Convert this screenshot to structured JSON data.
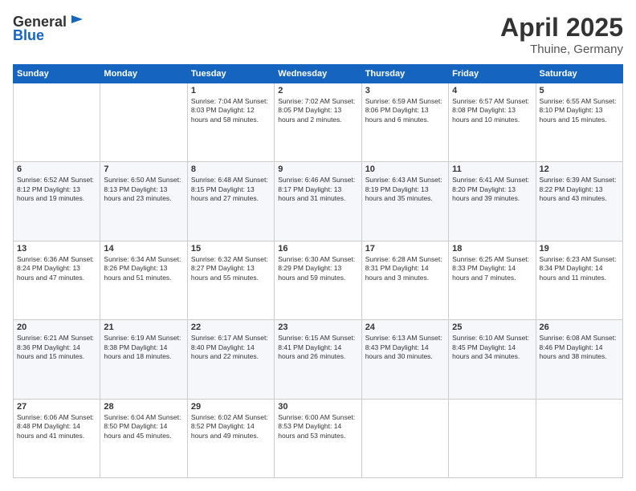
{
  "header": {
    "logo_line1": "General",
    "logo_line2": "Blue",
    "title": "April 2025",
    "location": "Thuine, Germany"
  },
  "days_of_week": [
    "Sunday",
    "Monday",
    "Tuesday",
    "Wednesday",
    "Thursday",
    "Friday",
    "Saturday"
  ],
  "weeks": [
    [
      {
        "day": "",
        "info": ""
      },
      {
        "day": "",
        "info": ""
      },
      {
        "day": "1",
        "info": "Sunrise: 7:04 AM\nSunset: 8:03 PM\nDaylight: 12 hours\nand 58 minutes."
      },
      {
        "day": "2",
        "info": "Sunrise: 7:02 AM\nSunset: 8:05 PM\nDaylight: 13 hours\nand 2 minutes."
      },
      {
        "day": "3",
        "info": "Sunrise: 6:59 AM\nSunset: 8:06 PM\nDaylight: 13 hours\nand 6 minutes."
      },
      {
        "day": "4",
        "info": "Sunrise: 6:57 AM\nSunset: 8:08 PM\nDaylight: 13 hours\nand 10 minutes."
      },
      {
        "day": "5",
        "info": "Sunrise: 6:55 AM\nSunset: 8:10 PM\nDaylight: 13 hours\nand 15 minutes."
      }
    ],
    [
      {
        "day": "6",
        "info": "Sunrise: 6:52 AM\nSunset: 8:12 PM\nDaylight: 13 hours\nand 19 minutes."
      },
      {
        "day": "7",
        "info": "Sunrise: 6:50 AM\nSunset: 8:13 PM\nDaylight: 13 hours\nand 23 minutes."
      },
      {
        "day": "8",
        "info": "Sunrise: 6:48 AM\nSunset: 8:15 PM\nDaylight: 13 hours\nand 27 minutes."
      },
      {
        "day": "9",
        "info": "Sunrise: 6:46 AM\nSunset: 8:17 PM\nDaylight: 13 hours\nand 31 minutes."
      },
      {
        "day": "10",
        "info": "Sunrise: 6:43 AM\nSunset: 8:19 PM\nDaylight: 13 hours\nand 35 minutes."
      },
      {
        "day": "11",
        "info": "Sunrise: 6:41 AM\nSunset: 8:20 PM\nDaylight: 13 hours\nand 39 minutes."
      },
      {
        "day": "12",
        "info": "Sunrise: 6:39 AM\nSunset: 8:22 PM\nDaylight: 13 hours\nand 43 minutes."
      }
    ],
    [
      {
        "day": "13",
        "info": "Sunrise: 6:36 AM\nSunset: 8:24 PM\nDaylight: 13 hours\nand 47 minutes."
      },
      {
        "day": "14",
        "info": "Sunrise: 6:34 AM\nSunset: 8:26 PM\nDaylight: 13 hours\nand 51 minutes."
      },
      {
        "day": "15",
        "info": "Sunrise: 6:32 AM\nSunset: 8:27 PM\nDaylight: 13 hours\nand 55 minutes."
      },
      {
        "day": "16",
        "info": "Sunrise: 6:30 AM\nSunset: 8:29 PM\nDaylight: 13 hours\nand 59 minutes."
      },
      {
        "day": "17",
        "info": "Sunrise: 6:28 AM\nSunset: 8:31 PM\nDaylight: 14 hours\nand 3 minutes."
      },
      {
        "day": "18",
        "info": "Sunrise: 6:25 AM\nSunset: 8:33 PM\nDaylight: 14 hours\nand 7 minutes."
      },
      {
        "day": "19",
        "info": "Sunrise: 6:23 AM\nSunset: 8:34 PM\nDaylight: 14 hours\nand 11 minutes."
      }
    ],
    [
      {
        "day": "20",
        "info": "Sunrise: 6:21 AM\nSunset: 8:36 PM\nDaylight: 14 hours\nand 15 minutes."
      },
      {
        "day": "21",
        "info": "Sunrise: 6:19 AM\nSunset: 8:38 PM\nDaylight: 14 hours\nand 18 minutes."
      },
      {
        "day": "22",
        "info": "Sunrise: 6:17 AM\nSunset: 8:40 PM\nDaylight: 14 hours\nand 22 minutes."
      },
      {
        "day": "23",
        "info": "Sunrise: 6:15 AM\nSunset: 8:41 PM\nDaylight: 14 hours\nand 26 minutes."
      },
      {
        "day": "24",
        "info": "Sunrise: 6:13 AM\nSunset: 8:43 PM\nDaylight: 14 hours\nand 30 minutes."
      },
      {
        "day": "25",
        "info": "Sunrise: 6:10 AM\nSunset: 8:45 PM\nDaylight: 14 hours\nand 34 minutes."
      },
      {
        "day": "26",
        "info": "Sunrise: 6:08 AM\nSunset: 8:46 PM\nDaylight: 14 hours\nand 38 minutes."
      }
    ],
    [
      {
        "day": "27",
        "info": "Sunrise: 6:06 AM\nSunset: 8:48 PM\nDaylight: 14 hours\nand 41 minutes."
      },
      {
        "day": "28",
        "info": "Sunrise: 6:04 AM\nSunset: 8:50 PM\nDaylight: 14 hours\nand 45 minutes."
      },
      {
        "day": "29",
        "info": "Sunrise: 6:02 AM\nSunset: 8:52 PM\nDaylight: 14 hours\nand 49 minutes."
      },
      {
        "day": "30",
        "info": "Sunrise: 6:00 AM\nSunset: 8:53 PM\nDaylight: 14 hours\nand 53 minutes."
      },
      {
        "day": "",
        "info": ""
      },
      {
        "day": "",
        "info": ""
      },
      {
        "day": "",
        "info": ""
      }
    ]
  ]
}
